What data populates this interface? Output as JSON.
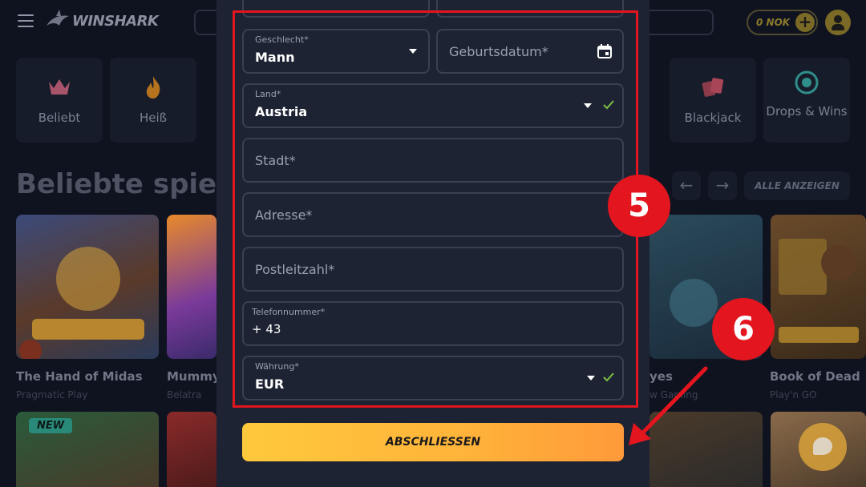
{
  "header": {
    "logo_text": "WINSHARK",
    "balance": "0 NOK",
    "plus": "+"
  },
  "categories": [
    {
      "label": "Beliebt",
      "icon": "crown-icon"
    },
    {
      "label": "Heiß",
      "icon": "fire-icon"
    },
    {
      "label": "Blackjack",
      "icon": "cards-icon"
    },
    {
      "label": "Drops & Wins",
      "icon": "drops-icon"
    }
  ],
  "section": {
    "title": "Beliebte spiele",
    "prev": "←",
    "next": "→",
    "show_all": "ALLE ANZEIGEN"
  },
  "games": [
    {
      "name": "The Hand of Midas",
      "provider": "Pragmatic Play"
    },
    {
      "name": "Mummyla",
      "provider": "Belatra"
    },
    {
      "name": "yes",
      "provider": "w Gaming"
    },
    {
      "name": "Book of Dead",
      "provider": "Play'n GO"
    }
  ],
  "game_badge": "NEW",
  "form": {
    "gender": {
      "label": "Geschlecht*",
      "value": "Mann"
    },
    "birthdate": {
      "placeholder": "Geburtsdatum*"
    },
    "country": {
      "label": "Land*",
      "value": "Austria"
    },
    "city": {
      "placeholder": "Stadt*"
    },
    "address": {
      "placeholder": "Adresse*"
    },
    "zip": {
      "placeholder": "Postleitzahl*"
    },
    "phone": {
      "label": "Telefonnummer*",
      "value": "+ 43"
    },
    "currency": {
      "label": "Währung*",
      "value": "EUR"
    },
    "submit": "ABSCHLIESSEN"
  },
  "annotations": {
    "step5": "5",
    "step6": "6"
  },
  "colors": {
    "accent_red": "#e3151e",
    "button_yellow": "#ffc93c",
    "check_green": "#7cc142"
  }
}
